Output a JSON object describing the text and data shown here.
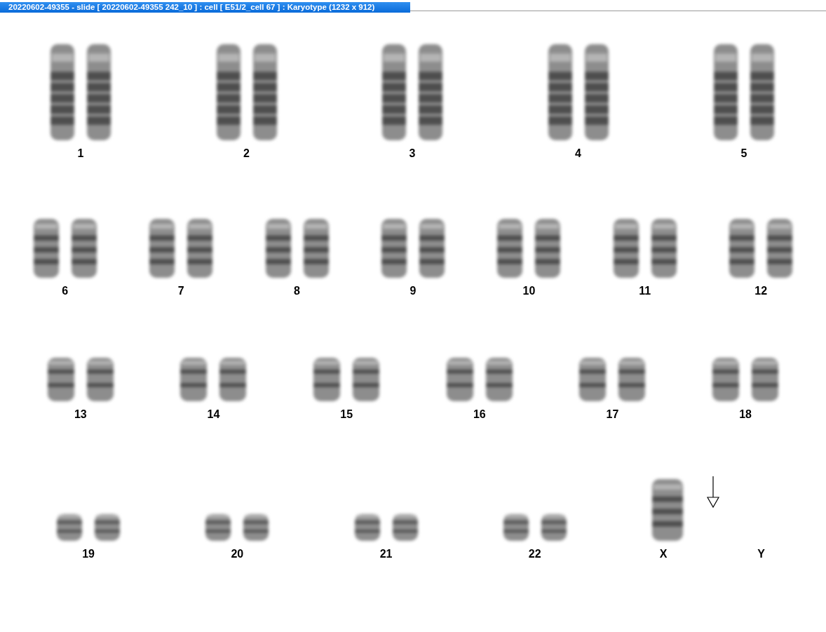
{
  "window": {
    "title": "20220602-49355 - slide [ 20220602-49355 242_10 ] : cell [ E51/2_cell 67 ] : Karyotype  (1232 x 912)"
  },
  "rows": [
    {
      "kind": "large",
      "classes": [
        {
          "label": "1",
          "marked": false,
          "copies": [
            {
              "kind": "chromosome"
            },
            {
              "kind": "chromosome"
            }
          ]
        },
        {
          "label": "2",
          "marked": false,
          "copies": [
            {
              "kind": "chromosome"
            },
            {
              "kind": "chromosome"
            }
          ]
        },
        {
          "label": "3",
          "marked": false,
          "copies": [
            {
              "kind": "chromosome"
            },
            {
              "kind": "chromosome"
            }
          ]
        },
        {
          "label": "4",
          "marked": false,
          "copies": [
            {
              "kind": "chromosome"
            },
            {
              "kind": "chromosome"
            }
          ]
        },
        {
          "label": "5",
          "marked": false,
          "copies": [
            {
              "kind": "chromosome"
            },
            {
              "kind": "chromosome"
            }
          ]
        }
      ]
    },
    {
      "kind": "medium",
      "classes": [
        {
          "label": "6",
          "marked": false,
          "copies": [
            {
              "kind": "chromosome"
            },
            {
              "kind": "chromosome"
            }
          ]
        },
        {
          "label": "7",
          "marked": false,
          "copies": [
            {
              "kind": "chromosome"
            },
            {
              "kind": "chromosome"
            }
          ]
        },
        {
          "label": "8",
          "marked": false,
          "copies": [
            {
              "kind": "chromosome"
            },
            {
              "kind": "chromosome"
            }
          ]
        },
        {
          "label": "9",
          "marked": false,
          "copies": [
            {
              "kind": "chromosome"
            },
            {
              "kind": "chromosome"
            }
          ]
        },
        {
          "label": "10",
          "marked": false,
          "copies": [
            {
              "kind": "chromosome"
            },
            {
              "kind": "chromosome"
            }
          ]
        },
        {
          "label": "11",
          "marked": false,
          "copies": [
            {
              "kind": "chromosome"
            },
            {
              "kind": "chromosome"
            }
          ]
        },
        {
          "label": "12",
          "marked": false,
          "copies": [
            {
              "kind": "chromosome"
            },
            {
              "kind": "chromosome"
            }
          ]
        }
      ]
    },
    {
      "kind": "small",
      "classes": [
        {
          "label": "13",
          "marked": false,
          "copies": [
            {
              "kind": "chromosome"
            },
            {
              "kind": "chromosome"
            }
          ]
        },
        {
          "label": "14",
          "marked": false,
          "copies": [
            {
              "kind": "chromosome"
            },
            {
              "kind": "chromosome"
            }
          ]
        },
        {
          "label": "15",
          "marked": false,
          "copies": [
            {
              "kind": "chromosome"
            },
            {
              "kind": "chromosome"
            }
          ]
        },
        {
          "label": "16",
          "marked": false,
          "copies": [
            {
              "kind": "chromosome"
            },
            {
              "kind": "chromosome"
            }
          ]
        },
        {
          "label": "17",
          "marked": false,
          "copies": [
            {
              "kind": "chromosome"
            },
            {
              "kind": "chromosome"
            }
          ]
        },
        {
          "label": "18",
          "marked": false,
          "copies": [
            {
              "kind": "chromosome"
            },
            {
              "kind": "chromosome"
            }
          ]
        }
      ]
    },
    {
      "kind": "tiny",
      "classes": [
        {
          "label": "19",
          "marked": false,
          "copies": [
            {
              "kind": "chromosome"
            },
            {
              "kind": "chromosome"
            }
          ]
        },
        {
          "label": "20",
          "marked": false,
          "copies": [
            {
              "kind": "chromosome"
            },
            {
              "kind": "chromosome"
            }
          ]
        },
        {
          "label": "21",
          "marked": false,
          "copies": [
            {
              "kind": "chromosome"
            },
            {
              "kind": "chromosome"
            }
          ]
        },
        {
          "label": "22",
          "marked": false,
          "copies": [
            {
              "kind": "chromosome"
            },
            {
              "kind": "chromosome"
            }
          ]
        },
        {
          "label": "X",
          "marked": true,
          "copies": [
            {
              "kind": "sex-chromosome"
            }
          ]
        },
        {
          "label": "Y",
          "marked": false
        }
      ]
    }
  ]
}
